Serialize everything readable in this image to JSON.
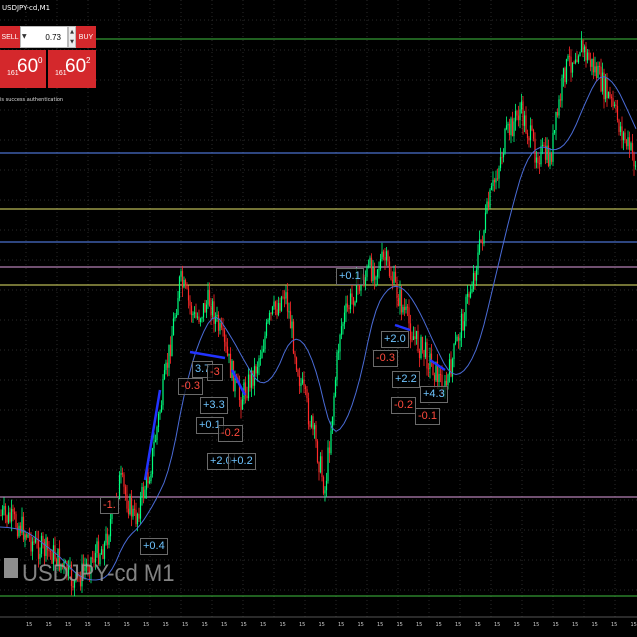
{
  "window": {
    "title": "USDJPY-cd,M1",
    "watermark": "USDJPY-cd M1"
  },
  "trade_panel": {
    "sell_label": "SELL",
    "buy_label": "BUY",
    "lot_value": "0.73",
    "bid_prefix": "161",
    "bid_main": "60",
    "bid_sup": "0",
    "ask_prefix": "161",
    "ask_main": "60",
    "ask_sup": "2"
  },
  "status": {
    "auth_message": "is success authentication"
  },
  "colors": {
    "background": "#000000",
    "trade_red": "#d4282c",
    "up_candle": "#00ff7f",
    "down_candle": "#ff2a2a",
    "moving_average": "#4a6bd6",
    "level_green": "#3fbf3f",
    "level_blue": "#5b8cff",
    "level_yellow": "#e6e66a",
    "level_pink": "#e0a0e0",
    "profit_blue": "#6ec4ff",
    "loss_red": "#ff4a3d"
  },
  "trade_labels": [
    {
      "text": "-1.",
      "tone": "red"
    },
    {
      "text": "-0.3",
      "tone": "red"
    },
    {
      "text": "3.7",
      "tone": "blue"
    },
    {
      "text": "-3",
      "tone": "red"
    },
    {
      "text": "+3.3",
      "tone": "blue"
    },
    {
      "text": "+0.1",
      "tone": "blue"
    },
    {
      "text": "-0.2",
      "tone": "red"
    },
    {
      "text": "+2.0",
      "tone": "blue"
    },
    {
      "text": "+0.2",
      "tone": "blue"
    },
    {
      "text": "+0.1",
      "tone": "blue"
    },
    {
      "text": "+2.0",
      "tone": "blue"
    },
    {
      "text": "-0.3",
      "tone": "red"
    },
    {
      "text": "+2.2",
      "tone": "blue"
    },
    {
      "text": "-0.2",
      "tone": "red"
    },
    {
      "text": "+4.3",
      "tone": "blue"
    },
    {
      "text": "-0.1",
      "tone": "red"
    },
    {
      "text": "-1.",
      "tone": "red"
    },
    {
      "text": "+0.4",
      "tone": "blue"
    }
  ],
  "time_axis": {
    "ticks": [
      "15",
      "15",
      "15",
      "15",
      "15",
      "15",
      "15",
      "15",
      "15",
      "15",
      "15",
      "15",
      "15",
      "15",
      "15",
      "15",
      "15",
      "15",
      "15",
      "15",
      "15",
      "15",
      "15",
      "15",
      "15",
      "15",
      "15",
      "15",
      "15",
      "15",
      "15",
      "15"
    ]
  }
}
